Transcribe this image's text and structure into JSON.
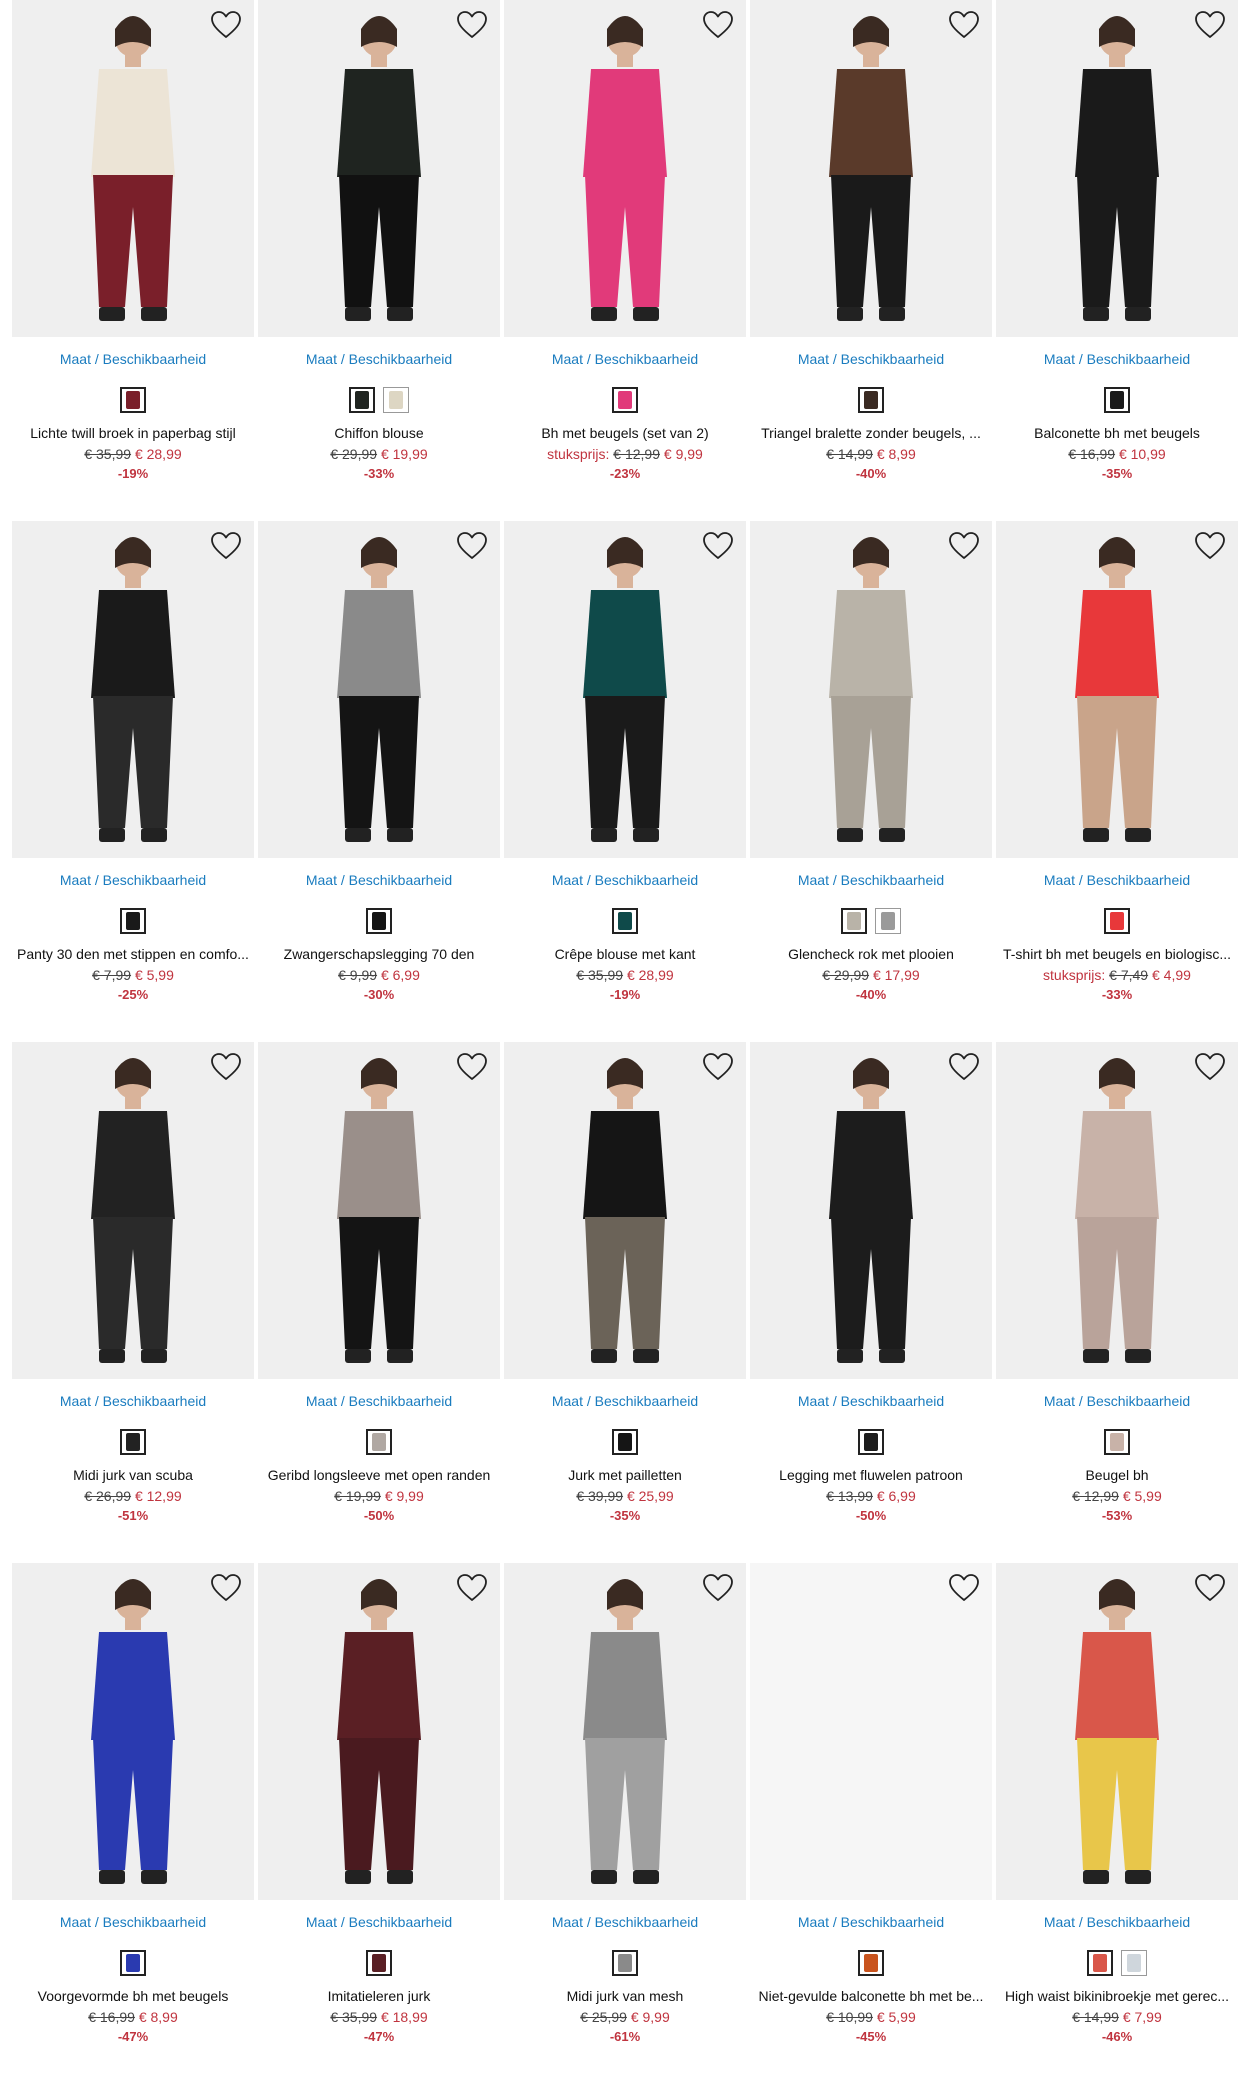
{
  "products": [
    {
      "name": "Lichte twill broek in paperbag stijl",
      "size_link": "Maat",
      "size_link2": "Beschikbaarheid",
      "old_price": "€ 35,99",
      "new_price": "€ 28,99",
      "discount": "-19%",
      "image": "woman-cream-top-red-pants",
      "fig_top": "#ece4d6",
      "fig_bottom": "#7a1f2a",
      "swatches": [
        "#7a1f2a"
      ]
    },
    {
      "name": "Chiffon blouse",
      "size_link": "Maat",
      "size_link2": "Beschikbaarheid",
      "old_price": "€ 29,99",
      "new_price": "€ 19,99",
      "discount": "-33%",
      "image": "woman-black-print-blouse",
      "fig_top": "#1f2420",
      "fig_bottom": "#111111",
      "swatches": [
        "#1f2420",
        "#ddd6c3"
      ]
    },
    {
      "name": "Bh met beugels (set van 2)",
      "size_link": "Maat",
      "size_link2": "Beschikbaarheid",
      "price_label": "stuksprijs:",
      "old_price": "€ 12,99",
      "new_price": "€ 9,99",
      "discount": "-23%",
      "image": "woman-pink-lace-bra",
      "fig_top": "#e13a7a",
      "fig_bottom": "#e13a7a",
      "swatches": [
        "#e13a7a"
      ]
    },
    {
      "name": "Triangel bralette zonder beugels, ...",
      "size_link": "Maat",
      "size_link2": "Beschikbaarheid",
      "old_price": "€ 14,99",
      "new_price": "€ 8,99",
      "discount": "-40%",
      "image": "woman-leopard-bralette",
      "fig_top": "#5a3a2a",
      "fig_bottom": "#1a1a1a",
      "swatches": [
        "#3a2a22"
      ]
    },
    {
      "name": "Balconette bh met beugels",
      "size_link": "Maat",
      "size_link2": "Beschikbaarheid",
      "old_price": "€ 16,99",
      "new_price": "€ 10,99",
      "discount": "-35%",
      "image": "woman-black-balconette-bra",
      "fig_top": "#1a1a1a",
      "fig_bottom": "#1a1a1a",
      "swatches": [
        "#1a1a1a"
      ]
    },
    {
      "name": "Panty 30 den met stippen en comfo...",
      "size_link": "Maat",
      "size_link2": "Beschikbaarheid",
      "old_price": "€ 7,99",
      "new_price": "€ 5,99",
      "discount": "-25%",
      "image": "legs-black-dotted-tights",
      "fig_top": "#1a1a1a",
      "fig_bottom": "#2a2a2a",
      "swatches": [
        "#1a1a1a"
      ]
    },
    {
      "name": "Zwangerschapslegging 70 den",
      "size_link": "Maat",
      "size_link2": "Beschikbaarheid",
      "old_price": "€ 9,99",
      "new_price": "€ 6,99",
      "discount": "-30%",
      "image": "legs-maternity-leggings",
      "fig_top": "#8a8a8a",
      "fig_bottom": "#141414",
      "swatches": [
        "#141414"
      ]
    },
    {
      "name": "Crêpe blouse met kant",
      "size_link": "Maat",
      "size_link2": "Beschikbaarheid",
      "old_price": "€ 35,99",
      "new_price": "€ 28,99",
      "discount": "-19%",
      "image": "woman-teal-blouse",
      "fig_top": "#0f4a4a",
      "fig_bottom": "#1a1a1a",
      "swatches": [
        "#0f4a4a"
      ]
    },
    {
      "name": "Glencheck rok met plooien",
      "size_link": "Maat",
      "size_link2": "Beschikbaarheid",
      "old_price": "€ 29,99",
      "new_price": "€ 17,99",
      "discount": "-40%",
      "image": "grey-check-pleated-skirt",
      "fig_top": "#b9b3a8",
      "fig_bottom": "#a8a196",
      "swatches": [
        "#b9b3a8",
        "#9a9a9a"
      ]
    },
    {
      "name": "T-shirt bh met beugels en biologisc...",
      "size_link": "Maat",
      "size_link2": "Beschikbaarheid",
      "price_label": "stuksprijs:",
      "old_price": "€ 7,49",
      "new_price": "€ 4,99",
      "discount": "-33%",
      "image": "woman-red-tshirt-bra",
      "fig_top": "#e8383a",
      "fig_bottom": "#c9a48a",
      "swatches": [
        "#e8383a"
      ]
    },
    {
      "name": "Midi jurk van scuba",
      "size_link": "Maat",
      "size_link2": "Beschikbaarheid",
      "old_price": "€ 26,99",
      "new_price": "€ 12,99",
      "discount": "-51%",
      "image": "woman-polka-dot-midi-dress",
      "fig_top": "#222222",
      "fig_bottom": "#2a2a2a",
      "swatches": [
        "#222222"
      ]
    },
    {
      "name": "Geribd longsleeve met open randen",
      "size_link": "Maat",
      "size_link2": "Beschikbaarheid",
      "old_price": "€ 19,99",
      "new_price": "€ 9,99",
      "discount": "-50%",
      "image": "woman-grey-ribbed-longsleeve",
      "fig_top": "#9a8f8a",
      "fig_bottom": "#141414",
      "swatches": [
        "#b0a8a3"
      ]
    },
    {
      "name": "Jurk met pailletten",
      "size_link": "Maat",
      "size_link2": "Beschikbaarheid",
      "old_price": "€ 39,99",
      "new_price": "€ 25,99",
      "discount": "-35%",
      "image": "woman-sequin-dress",
      "fig_top": "#151515",
      "fig_bottom": "#6b6358",
      "swatches": [
        "#151515"
      ]
    },
    {
      "name": "Legging met fluwelen patroon",
      "size_link": "Maat",
      "size_link2": "Beschikbaarheid",
      "old_price": "€ 13,99",
      "new_price": "€ 6,99",
      "discount": "-50%",
      "image": "black-velvet-leggings",
      "fig_top": "#1c1c1c",
      "fig_bottom": "#1c1c1c",
      "swatches": [
        "#1c1c1c"
      ]
    },
    {
      "name": "Beugel bh",
      "size_link": "Maat",
      "size_link2": "Beschikbaarheid",
      "old_price": "€ 12,99",
      "new_price": "€ 5,99",
      "discount": "-53%",
      "image": "woman-beige-underwire-bra",
      "fig_top": "#c8b2a8",
      "fig_bottom": "#b9a39a",
      "swatches": [
        "#c8b2a8"
      ]
    },
    {
      "name": "Voorgevormde bh met beugels",
      "size_link": "Maat",
      "size_link2": "Beschikbaarheid",
      "old_price": "€ 16,99",
      "new_price": "€ 8,99",
      "discount": "-47%",
      "image": "woman-blue-padded-bra",
      "fig_top": "#2a3ab0",
      "fig_bottom": "#2a3ab0",
      "swatches": [
        "#2a3ab0"
      ]
    },
    {
      "name": "Imitatieleren jurk",
      "size_link": "Maat",
      "size_link2": "Beschikbaarheid",
      "old_price": "€ 35,99",
      "new_price": "€ 18,99",
      "discount": "-47%",
      "image": "woman-burgundy-faux-leather-dress",
      "fig_top": "#5a1f24",
      "fig_bottom": "#4a1a1f",
      "swatches": [
        "#5a1f24"
      ]
    },
    {
      "name": "Midi jurk van mesh",
      "size_link": "Maat",
      "size_link2": "Beschikbaarheid",
      "old_price": "€ 25,99",
      "new_price": "€ 9,99",
      "discount": "-61%",
      "image": "woman-grey-mesh-midi-dress",
      "fig_top": "#8a8a8a",
      "fig_bottom": "#a0a0a0",
      "swatches": [
        "#8a8a8a"
      ]
    },
    {
      "name": "Niet-gevulde balconette bh met be...",
      "size_link": "Maat",
      "size_link2": "Beschikbaarheid",
      "old_price": "€ 10,99",
      "new_price": "€ 5,99",
      "discount": "-45%",
      "image": "",
      "fig_top": "",
      "fig_bottom": "",
      "swatches": [
        "#c9541e"
      ]
    },
    {
      "name": "High waist bikinibroekje met gerec...",
      "size_link": "Maat",
      "size_link2": "Beschikbaarheid",
      "old_price": "€ 14,99",
      "new_price": "€ 7,99",
      "discount": "-46%",
      "image": "woman-striped-bikini",
      "fig_top": "#d9574a",
      "fig_bottom": "#e8c64a",
      "swatches": [
        "#d9574a",
        "#cfd6dc"
      ]
    }
  ]
}
